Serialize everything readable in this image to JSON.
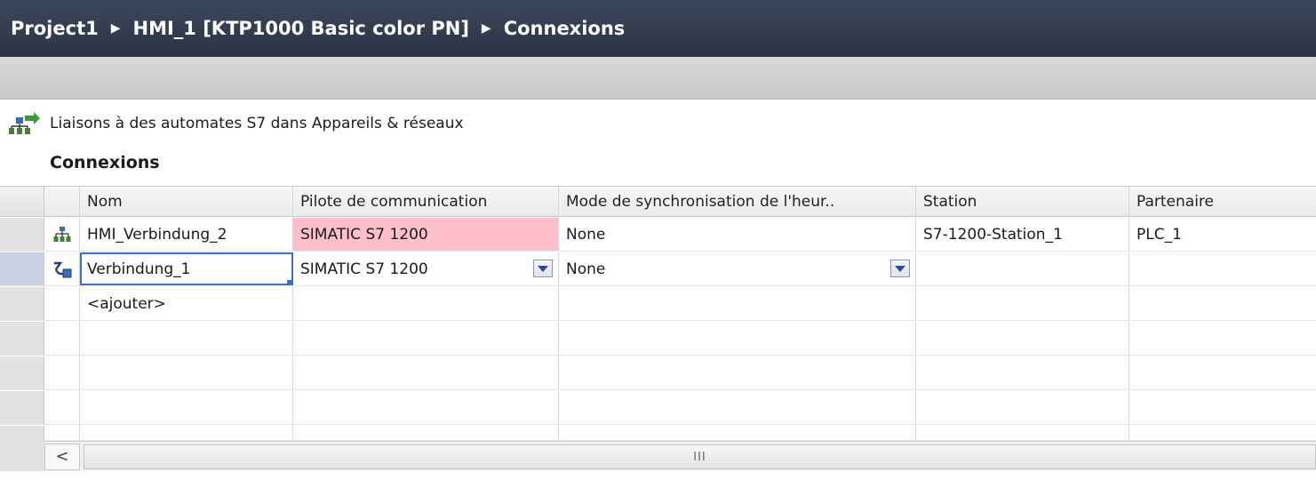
{
  "breadcrumb": {
    "project": "Project1",
    "device": "HMI_1 [KTP1000 Basic color PN]",
    "page": "Connexions",
    "separator": "▶"
  },
  "link": {
    "icon": "network-link-icon",
    "text": "Liaisons à des automates S7 dans Appareils & réseaux"
  },
  "section": {
    "title": "Connexions"
  },
  "table": {
    "columns": [
      "Nom",
      "Pilote de communication",
      "Mode de synchronisation de l'heur..",
      "Station",
      "Partenaire"
    ],
    "rows": [
      {
        "icon": "network-connection-icon",
        "name": "HMI_Verbindung_2",
        "driver": "SIMATIC S7 1200",
        "sync": "None",
        "station": "S7-1200-Station_1",
        "partner": "PLC_1"
      },
      {
        "icon": "new-connection-icon",
        "name": "Verbindung_1",
        "driver": "SIMATIC S7 1200",
        "sync": "None",
        "station": "",
        "partner": ""
      }
    ],
    "add_label": "<ajouter>"
  },
  "scrollbar": {
    "left_arrow": "<",
    "grip": "III"
  },
  "colors": {
    "title_bg": "#2f3749",
    "error_cell": "#ffc0cb",
    "selection": "#3d6fd1"
  }
}
